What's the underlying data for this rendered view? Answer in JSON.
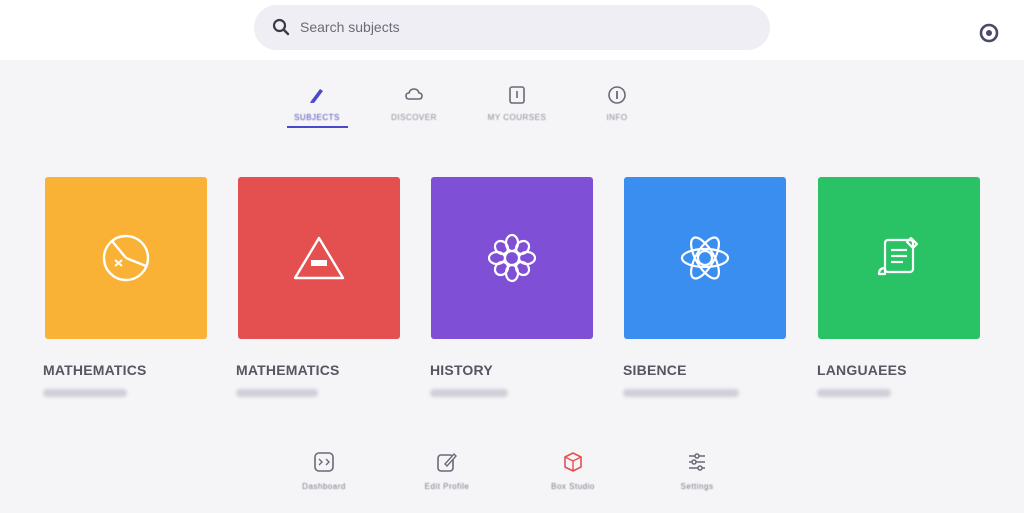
{
  "search": {
    "placeholder": "Search subjects",
    "icon": "search-icon",
    "action_icon": "target-icon"
  },
  "colors": {
    "accent": "#4b49c9",
    "mathematics_1": "#f9b236",
    "mathematics_2": "#e4504f",
    "history": "#7f4fd6",
    "science": "#3a8ef0",
    "languages": "#29c264"
  },
  "tabs": [
    {
      "label": "Subjects",
      "icon": "pen-icon",
      "active": true
    },
    {
      "label": "Discover",
      "icon": "cloud-icon",
      "active": false
    },
    {
      "label": "My Courses",
      "icon": "book-icon",
      "active": false
    },
    {
      "label": "Info",
      "icon": "info-icon",
      "active": false
    }
  ],
  "cards": [
    {
      "title": "MATHEMATICS",
      "subtitle": "",
      "icon": "pie-chart-icon"
    },
    {
      "title": "MATHEMATICS",
      "subtitle": "",
      "icon": "triangle-icon"
    },
    {
      "title": "HISTORY",
      "subtitle": "",
      "icon": "flower-icon"
    },
    {
      "title": "SIBENCE",
      "subtitle": "",
      "icon": "atom-icon"
    },
    {
      "title": "LANGUAEES",
      "subtitle": "",
      "icon": "document-edit-icon"
    }
  ],
  "bottom_nav": [
    {
      "label": "Dashboard",
      "icon": "grid-icon"
    },
    {
      "label": "Edit Profile",
      "icon": "edit-icon"
    },
    {
      "label": "Box Studio",
      "icon": "box-icon"
    },
    {
      "label": "Settings",
      "icon": "settings-icon"
    }
  ]
}
